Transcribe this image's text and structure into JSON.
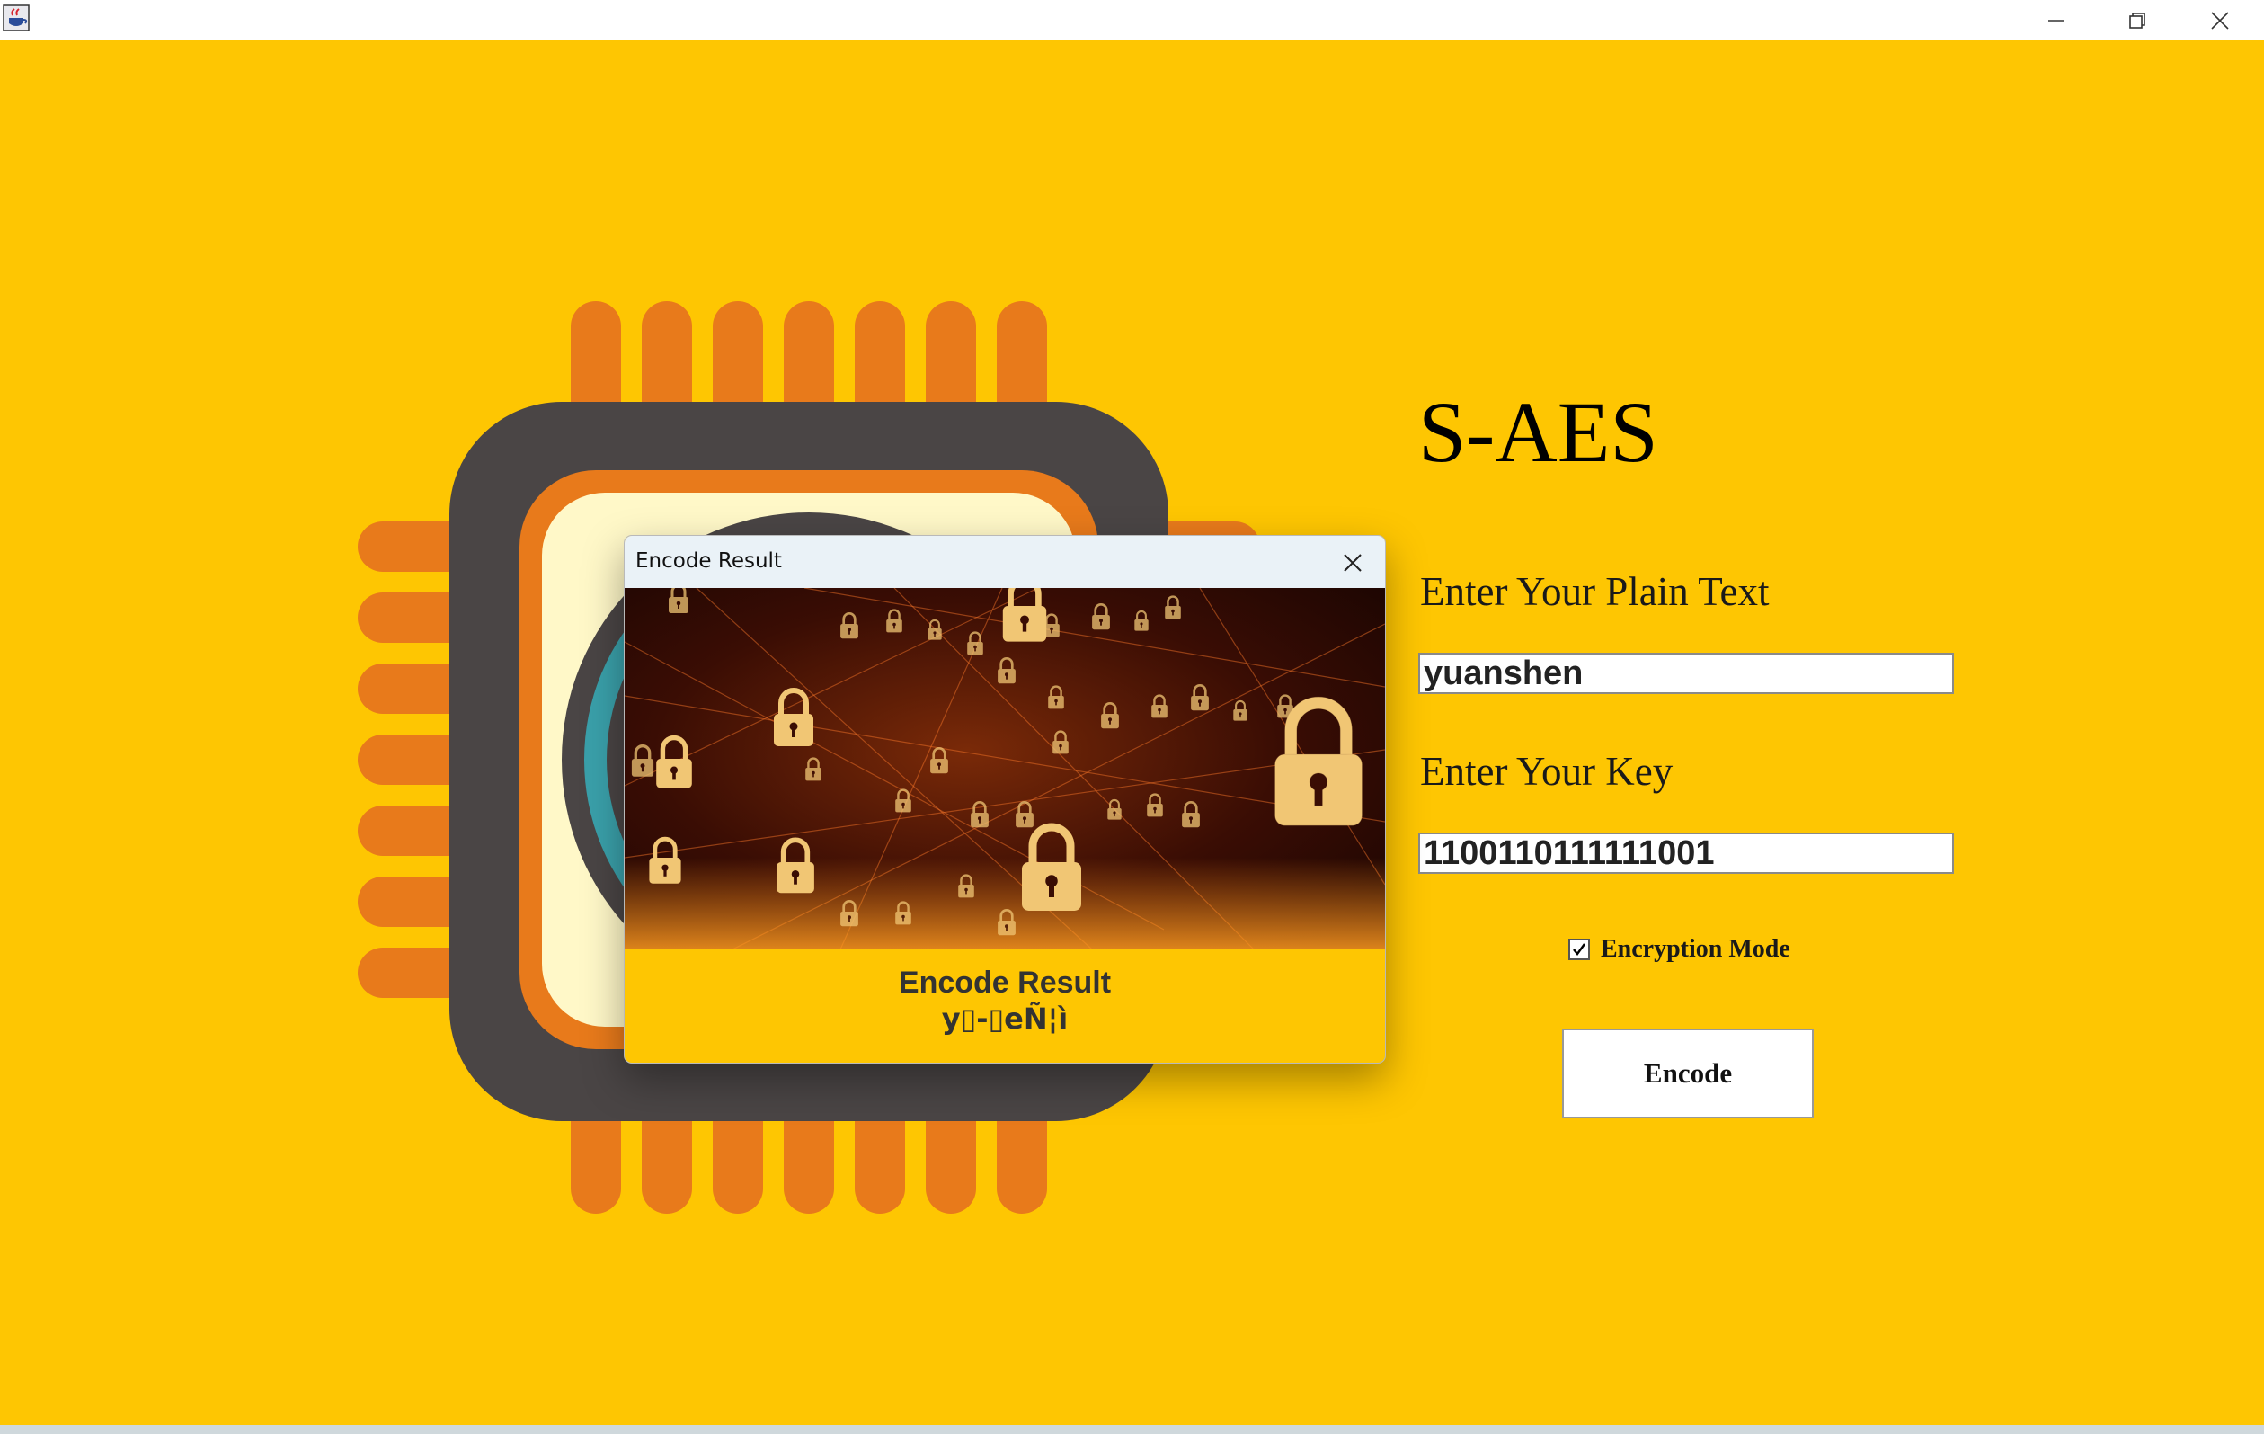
{
  "window": {
    "title": "",
    "icons": {
      "app": "java-cup-icon",
      "minimize": "minimize-icon",
      "maximize": "restore-icon",
      "close": "close-icon"
    }
  },
  "main": {
    "app_title": "S-AES",
    "plain_text_label": "Enter Your Plain Text",
    "plain_text_value": "yuanshen",
    "key_label": "Enter Your Key",
    "key_value": "1100110111111001",
    "encryption_mode_label": "Encryption Mode",
    "encryption_mode_checked": true,
    "encode_button_label": "Encode"
  },
  "dialog": {
    "title": "Encode Result",
    "image": "padlock-network-image",
    "result_heading": "Encode Result",
    "result_value": "y▯-▯eÑ¦ì"
  },
  "colors": {
    "background": "#FEC602",
    "chip_pins": "#E87A1B",
    "chip_body": "#4A4545",
    "chip_core": "#FFF8C8",
    "dialog_title_bg": "#EAF2F7"
  }
}
